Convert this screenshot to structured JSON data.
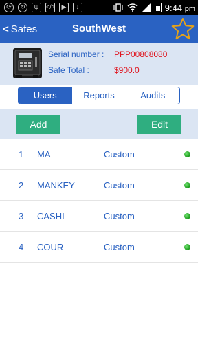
{
  "status_bar": {
    "time": "9:44",
    "time_suffix": "pm",
    "icons": [
      "sync-icon",
      "refresh-icon",
      "usb-icon",
      "code-icon",
      "youtube-icon",
      "download-icon",
      "vibrate-icon",
      "wifi-icon",
      "signal-icon",
      "battery-icon"
    ]
  },
  "nav": {
    "back_label": "Safes",
    "title": "SouthWest",
    "favorite_icon": "star-outline-icon"
  },
  "safe_info": {
    "icon": "safe-icon",
    "serial_label": "Serial number :",
    "serial_value": "PPP00808080",
    "total_label": "Safe Total :",
    "total_value": "$900.0"
  },
  "tabs": [
    {
      "label": "Users",
      "active": true
    },
    {
      "label": "Reports",
      "active": false
    },
    {
      "label": "Audits",
      "active": false
    }
  ],
  "actions": {
    "add_label": "Add",
    "edit_label": "Edit"
  },
  "users": [
    {
      "num": "1",
      "name": "MA",
      "role": "Custom",
      "status": "active"
    },
    {
      "num": "2",
      "name": "MANKEY",
      "role": "Custom",
      "status": "active"
    },
    {
      "num": "3",
      "name": "CASHI",
      "role": "Custom",
      "status": "active"
    },
    {
      "num": "4",
      "name": "COUR",
      "role": "Custom",
      "status": "active"
    }
  ],
  "colors": {
    "primary": "#2a62c2",
    "panel": "#dbe5f3",
    "button": "#2fae80",
    "value_red": "#e0141e",
    "status_green": "#1a9a1a",
    "star": "#e8a317"
  }
}
